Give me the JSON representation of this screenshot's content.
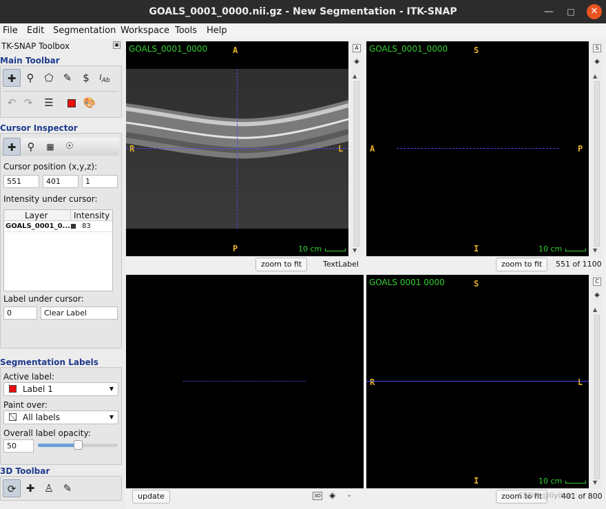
{
  "window": {
    "title": "GOALS_0001_0000.nii.gz - New Segmentation - ITK-SNAP",
    "min_icon": "minimize-icon",
    "max_icon": "maximize-icon",
    "close_icon": "close-icon"
  },
  "menubar": {
    "items": [
      "File",
      "Edit",
      "Segmentation",
      "Workspace",
      "Tools",
      "Help"
    ]
  },
  "toolbox": {
    "title": "TK-SNAP Toolbox",
    "main_toolbar": {
      "title": "Main Toolbar",
      "tools": [
        "crosshair-tool-icon",
        "zoom-tool-icon",
        "polygon-tool-icon",
        "paintbrush-tool-icon",
        "snake-tool-icon",
        "annotation-tool-icon"
      ],
      "actions": [
        "undo-icon",
        "redo-icon",
        "layers-icon",
        "label-color-icon",
        "palette-icon"
      ]
    },
    "cursor_inspector": {
      "title": "Cursor Inspector",
      "tabs": [
        "cursor-tab-icon",
        "zoom-tab-icon",
        "grid-tab-icon",
        "sync-tab-icon"
      ],
      "position_label": "Cursor position (x,y,z):",
      "x": "551",
      "y": "401",
      "z": "1",
      "intensity_label": "Intensity under cursor:",
      "table": {
        "headers": [
          "Layer",
          "Intensity"
        ],
        "rows": [
          {
            "layer": "GOALS_0001_0...",
            "intensity": "83"
          }
        ]
      },
      "label_under_cursor": "Label under cursor:",
      "label_id": "0",
      "label_name": "Clear Label"
    },
    "segmentation_labels": {
      "title": "Segmentation Labels",
      "active_label_caption": "Active label:",
      "active_label": "Label 1",
      "active_color": "#e8100e",
      "paint_over_caption": "Paint over:",
      "paint_over": "All labels",
      "opacity_caption": "Overall label opacity:",
      "opacity": "50",
      "opacity_fraction": 0.5
    },
    "toolbar_3d": {
      "title": "3D Toolbar",
      "tools": [
        "rotate-3d-icon",
        "crosshair-3d-icon",
        "spray-3d-icon",
        "scalpel-3d-icon"
      ]
    }
  },
  "viewports": {
    "axial": {
      "name": "GOALS_0001_0000",
      "top": "A",
      "bottom": "P",
      "left": "R",
      "right": "L",
      "scale": "10 cm",
      "side_letter": "A",
      "zoom_label": "zoom to fit",
      "text_label": "TextLabel"
    },
    "sagittal": {
      "name": "GOALS_0001_0000",
      "top": "S",
      "bottom": "I",
      "left": "A",
      "right": "P",
      "scale": "10 cm",
      "side_letter": "S",
      "zoom_label": "zoom to fit",
      "slice": "551 of 1100"
    },
    "three_d": {
      "update_label": "update"
    },
    "coronal": {
      "name": "GOALS  0001  0000",
      "top": "S",
      "bottom": "I",
      "left": "R",
      "right": "L",
      "scale": "10 cm",
      "side_letter": "C",
      "zoom_label": "zoom to fit",
      "slice": "401 of 800",
      "watermark": "CSDN @liyihao"
    }
  },
  "colors": {
    "orientation": "#e9b32a",
    "viewport_text": "#34d134",
    "crosshair": "#4a4aff",
    "section_title": "#1e3a8c"
  }
}
